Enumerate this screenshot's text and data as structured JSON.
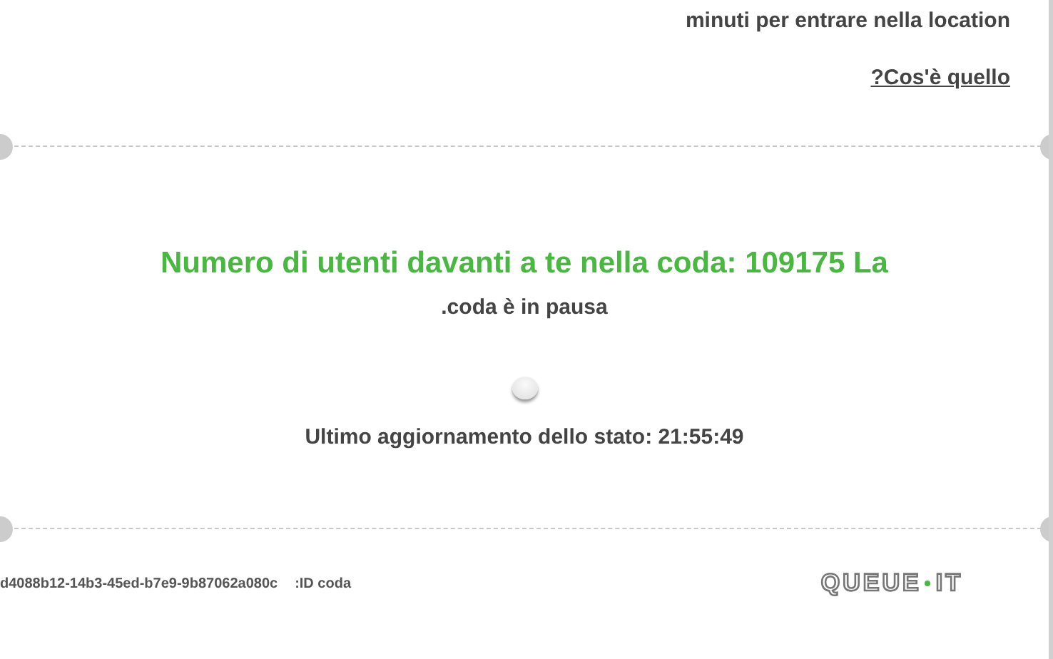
{
  "header": {
    "wait_text": "minuti per entrare nella location",
    "help_link": "?Cos'è quello"
  },
  "main": {
    "queue_text": "Numero di utenti davanti a te nella coda: 109175 La",
    "paused_text": ".coda è in pausa",
    "status_text": "Ultimo aggiornamento dello stato: 21:55:49"
  },
  "footer": {
    "queue_id": "d4088b12-14b3-45ed-b7e9-9b87062a080c",
    "queue_id_label": ":ID coda",
    "logo_left": "QUEUE",
    "logo_right": "IT"
  }
}
